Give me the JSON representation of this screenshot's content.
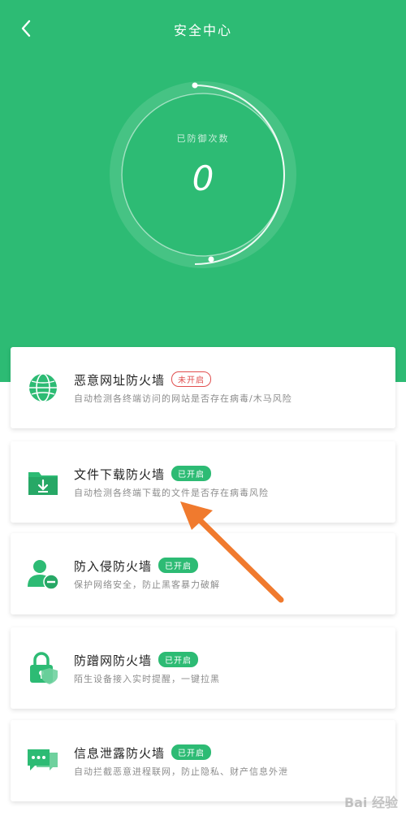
{
  "header": {
    "title": "安全中心"
  },
  "dial": {
    "label": "已防御次数",
    "value": "0"
  },
  "cards": [
    {
      "title": "恶意网址防火墙",
      "badge": "未开启",
      "status": "off",
      "desc": "自动检测各终端访问的网站是否存在病毒/木马风险",
      "icon": "globe-icon"
    },
    {
      "title": "文件下载防火墙",
      "badge": "已开启",
      "status": "on",
      "desc": "自动检测各终端下载的文件是否存在病毒风险",
      "icon": "download-folder-icon"
    },
    {
      "title": "防入侵防火墙",
      "badge": "已开启",
      "status": "on",
      "desc": "保护网络安全，防止黑客暴力破解",
      "icon": "user-block-icon"
    },
    {
      "title": "防蹭网防火墙",
      "badge": "已开启",
      "status": "on",
      "desc": "陌生设备接入实时提醒，一键拉黑",
      "icon": "lock-shield-icon"
    },
    {
      "title": "信息泄露防火墙",
      "badge": "已开启",
      "status": "on",
      "desc": "自动拦截恶意进程联网，防止隐私、财产信息外泄",
      "icon": "chat-bubble-icon"
    }
  ],
  "colors": {
    "brand": "#2dbb74",
    "off": "#e04e4e",
    "arrow": "#f07a2e"
  },
  "watermark": "Bai 经验"
}
